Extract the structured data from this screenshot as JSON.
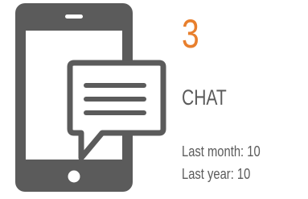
{
  "widget": {
    "icon": "smartphone-chat-icon",
    "count": "3",
    "label": "CHAT",
    "last_month_label": "Last month:",
    "last_month_value": "10",
    "last_year_label": "Last year:",
    "last_year_value": "10"
  },
  "colors": {
    "accent": "#e87f2d",
    "icon": "#5b5b5b",
    "text": "#5b5b5b",
    "background": "#ffffff"
  }
}
